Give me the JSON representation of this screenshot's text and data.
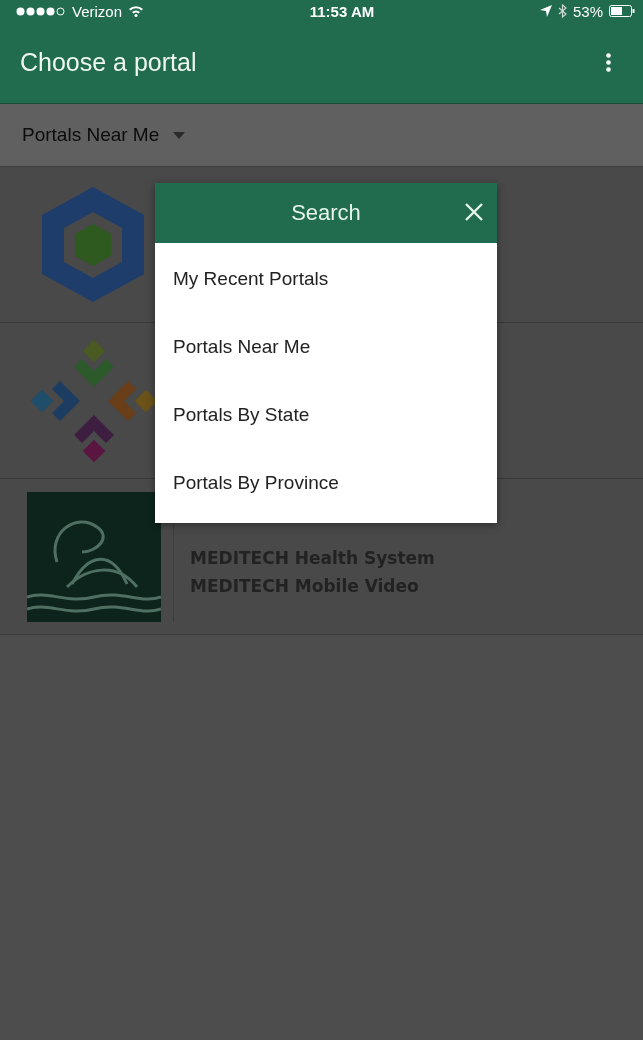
{
  "status_bar": {
    "carrier": "Verizon",
    "time": "11:53 AM",
    "battery": "53%"
  },
  "app_bar": {
    "title": "Choose a portal"
  },
  "filter": {
    "label": "Portals Near Me"
  },
  "portals": [
    {
      "kind": "hexagon"
    },
    {
      "kind": "mosaic"
    },
    {
      "kind": "wave",
      "lines": [
        "MEDITECH Health System",
        "MEDITECH Mobile Video"
      ]
    }
  ],
  "dialog": {
    "title": "Search",
    "options": [
      "My Recent Portals",
      "Portals Near Me",
      "Portals By State",
      "Portals By Province"
    ]
  }
}
